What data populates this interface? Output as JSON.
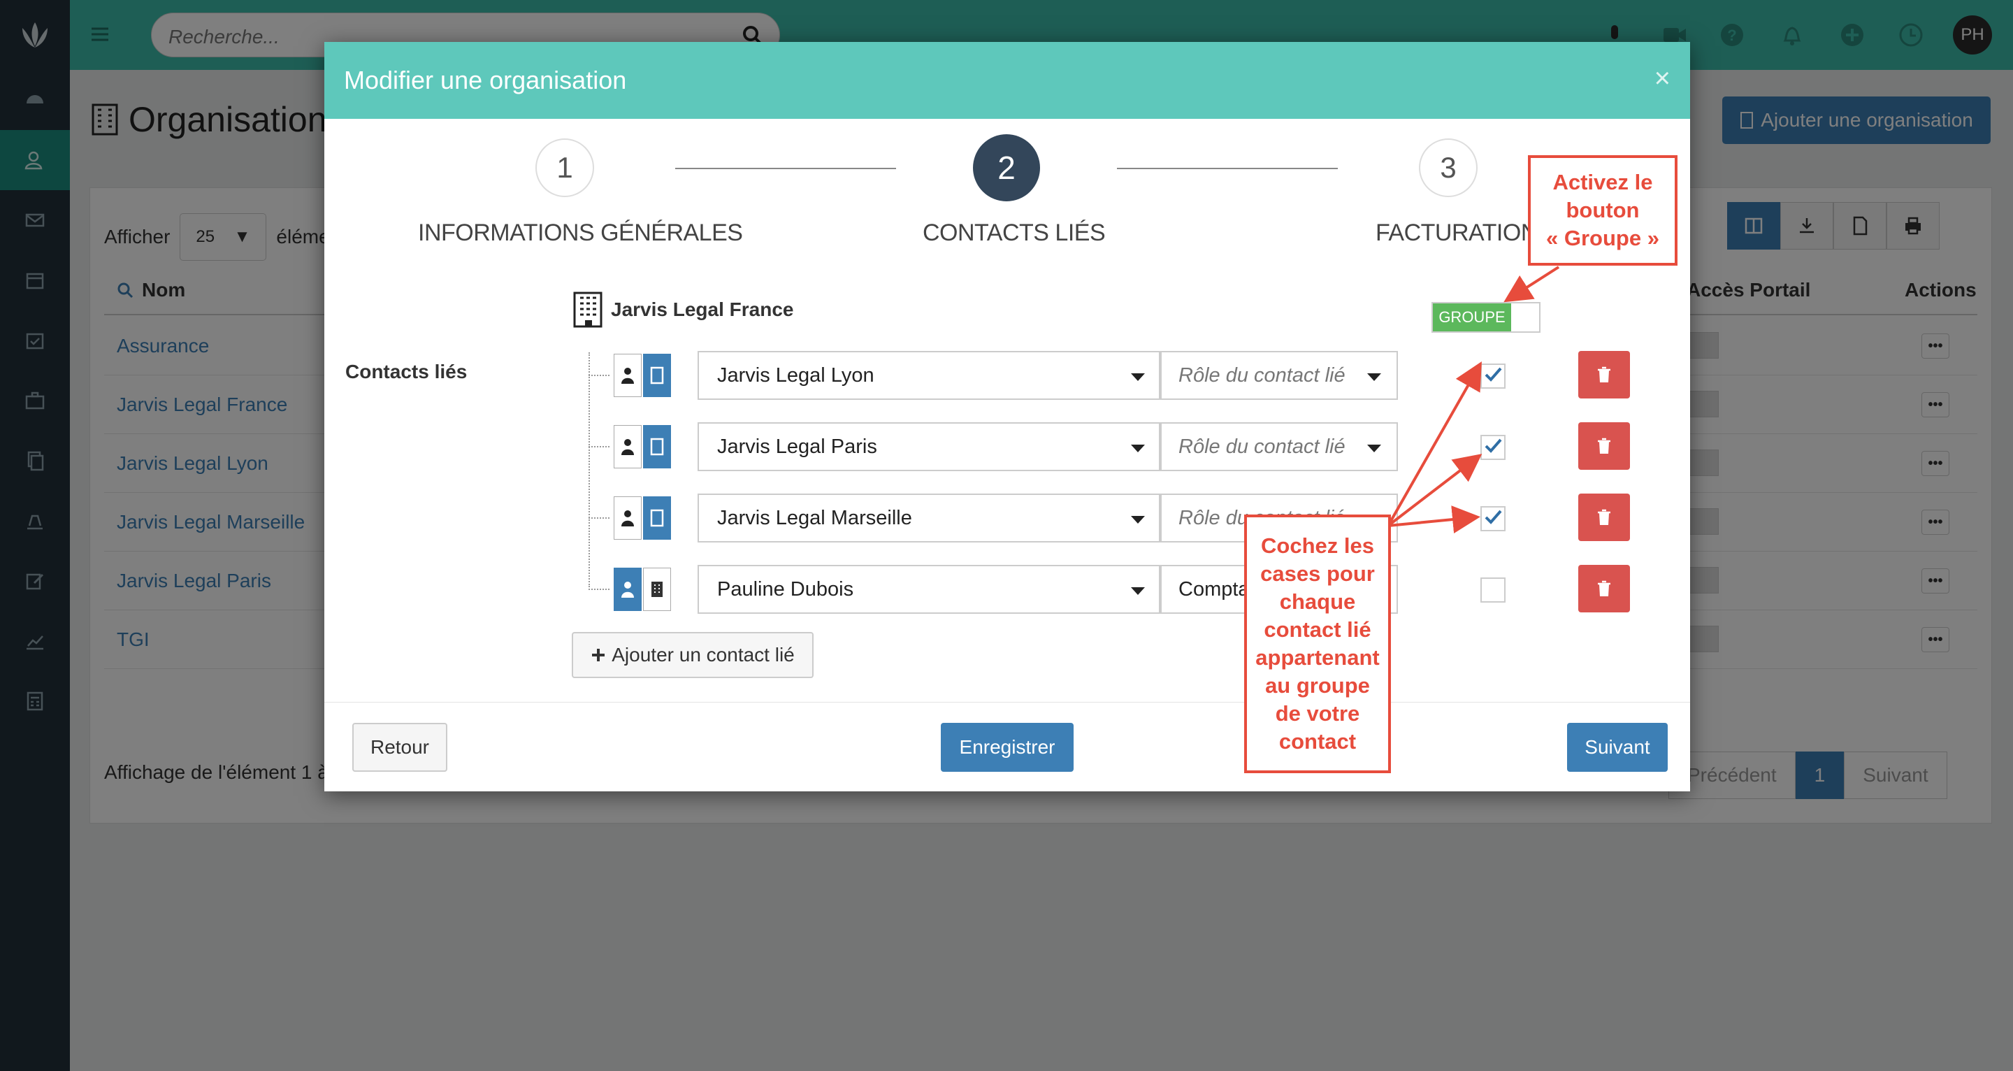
{
  "app": {
    "search_placeholder": "Recherche...",
    "avatar": "PH",
    "page_title": "Organisations",
    "add_org_button": "Ajouter une organisation",
    "show_label": "Afficher",
    "page_size": "25",
    "show_suffix": "éléme",
    "columns": {
      "name": "Nom",
      "portal": "Accès Portail",
      "actions": "Actions"
    },
    "rows": [
      {
        "name": "Assurance"
      },
      {
        "name": "Jarvis Legal France"
      },
      {
        "name": "Jarvis Legal Lyon"
      },
      {
        "name": "Jarvis Legal Marseille"
      },
      {
        "name": "Jarvis Legal Paris"
      },
      {
        "name": "TGI"
      }
    ],
    "row_actions": "•••",
    "footer_info": "Affichage de l'élément 1 à",
    "pager": {
      "prev": "Précédent",
      "current": "1",
      "next": "Suivant"
    }
  },
  "modal": {
    "title": "Modifier une organisation",
    "close": "×",
    "steps": [
      {
        "number": "1",
        "label": "INFORMATIONS GÉNÉRALES"
      },
      {
        "number": "2",
        "label": "CONTACTS LIÉS"
      },
      {
        "number": "3",
        "label": "FACTURATION"
      }
    ],
    "section_label": "Contacts liés",
    "organisation_name": "Jarvis Legal France",
    "groupe_toggle": "GROUPE",
    "contacts": [
      {
        "name": "Jarvis Legal Lyon",
        "role": "Rôle du contact lié",
        "role_is_placeholder": true,
        "checked": true
      },
      {
        "name": "Jarvis Legal Paris",
        "role": "Rôle du contact lié",
        "role_is_placeholder": true,
        "checked": true
      },
      {
        "name": "Jarvis Legal Marseille",
        "role": "Rôle du contact lié",
        "role_is_placeholder": true,
        "checked": true
      },
      {
        "name": "Pauline Dubois",
        "role": "Comptable",
        "role_is_placeholder": false,
        "checked": false
      }
    ],
    "add_contact_button": "Ajouter un contact lié",
    "back_button": "Retour",
    "save_button": "Enregistrer",
    "next_button": "Suivant"
  },
  "annotations": {
    "callout_groupe": "Activez le bouton « Groupe »",
    "callout_groupe_lines": [
      "Activez le",
      "bouton",
      "« Groupe »"
    ],
    "callout_checks_lines": [
      "Cochez les",
      "cases pour",
      "chaque",
      "contact lié",
      "appartenant",
      "au groupe",
      "de votre",
      "contact"
    ]
  },
  "colors": {
    "topbar": "#3dbdaa",
    "sidebar": "#23303a",
    "modal_header": "#5ec8bb",
    "primary": "#3d7fb5",
    "danger": "#d9534f",
    "toggle_on": "#5cb85c",
    "annotation": "#e74c3c",
    "step_active": "#33465a"
  }
}
